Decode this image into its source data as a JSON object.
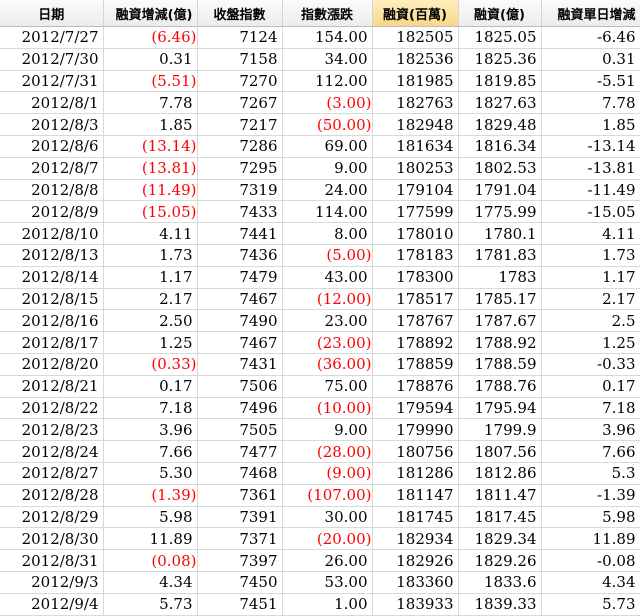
{
  "headers": [
    "日期",
    "融資增減(億)",
    "收盤指數",
    "指數漲跌",
    "融資(百萬)",
    "融資(億)",
    "融資單日增減"
  ],
  "rows": [
    [
      "2012/7/27",
      "(6.46)",
      "7124",
      "154.00",
      "182505",
      "1825.05",
      "-6.46"
    ],
    [
      "2012/7/30",
      "0.31",
      "7158",
      "34.00",
      "182536",
      "1825.36",
      "0.31"
    ],
    [
      "2012/7/31",
      "(5.51)",
      "7270",
      "112.00",
      "181985",
      "1819.85",
      "-5.51"
    ],
    [
      "2012/8/1",
      "7.78",
      "7267",
      "(3.00)",
      "182763",
      "1827.63",
      "7.78"
    ],
    [
      "2012/8/3",
      "1.85",
      "7217",
      "(50.00)",
      "182948",
      "1829.48",
      "1.85"
    ],
    [
      "2012/8/6",
      "(13.14)",
      "7286",
      "69.00",
      "181634",
      "1816.34",
      "-13.14"
    ],
    [
      "2012/8/7",
      "(13.81)",
      "7295",
      "9.00",
      "180253",
      "1802.53",
      "-13.81"
    ],
    [
      "2012/8/8",
      "(11.49)",
      "7319",
      "24.00",
      "179104",
      "1791.04",
      "-11.49"
    ],
    [
      "2012/8/9",
      "(15.05)",
      "7433",
      "114.00",
      "177599",
      "1775.99",
      "-15.05"
    ],
    [
      "2012/8/10",
      "4.11",
      "7441",
      "8.00",
      "178010",
      "1780.1",
      "4.11"
    ],
    [
      "2012/8/13",
      "1.73",
      "7436",
      "(5.00)",
      "178183",
      "1781.83",
      "1.73"
    ],
    [
      "2012/8/14",
      "1.17",
      "7479",
      "43.00",
      "178300",
      "1783",
      "1.17"
    ],
    [
      "2012/8/15",
      "2.17",
      "7467",
      "(12.00)",
      "178517",
      "1785.17",
      "2.17"
    ],
    [
      "2012/8/16",
      "2.50",
      "7490",
      "23.00",
      "178767",
      "1787.67",
      "2.5"
    ],
    [
      "2012/8/17",
      "1.25",
      "7467",
      "(23.00)",
      "178892",
      "1788.92",
      "1.25"
    ],
    [
      "2012/8/20",
      "(0.33)",
      "7431",
      "(36.00)",
      "178859",
      "1788.59",
      "-0.33"
    ],
    [
      "2012/8/21",
      "0.17",
      "7506",
      "75.00",
      "178876",
      "1788.76",
      "0.17"
    ],
    [
      "2012/8/22",
      "7.18",
      "7496",
      "(10.00)",
      "179594",
      "1795.94",
      "7.18"
    ],
    [
      "2012/8/23",
      "3.96",
      "7505",
      "9.00",
      "179990",
      "1799.9",
      "3.96"
    ],
    [
      "2012/8/24",
      "7.66",
      "7477",
      "(28.00)",
      "180756",
      "1807.56",
      "7.66"
    ],
    [
      "2012/8/27",
      "5.30",
      "7468",
      "(9.00)",
      "181286",
      "1812.86",
      "5.3"
    ],
    [
      "2012/8/28",
      "(1.39)",
      "7361",
      "(107.00)",
      "181147",
      "1811.47",
      "-1.39"
    ],
    [
      "2012/8/29",
      "5.98",
      "7391",
      "30.00",
      "181745",
      "1817.45",
      "5.98"
    ],
    [
      "2012/8/30",
      "11.89",
      "7371",
      "(20.00)",
      "182934",
      "1829.34",
      "11.89"
    ],
    [
      "2012/8/31",
      "(0.08)",
      "7397",
      "26.00",
      "182926",
      "1829.26",
      "-0.08"
    ],
    [
      "2012/9/3",
      "4.34",
      "7450",
      "53.00",
      "183360",
      "1833.6",
      "4.34"
    ],
    [
      "2012/9/4",
      "5.73",
      "7451",
      "1.00",
      "183933",
      "1839.33",
      "5.73"
    ]
  ],
  "colors": {
    "negative": "#ff0000",
    "header_bg": "#f2f2f2",
    "header_highlight": "#f7d889",
    "grid": "#d9d9d9"
  }
}
